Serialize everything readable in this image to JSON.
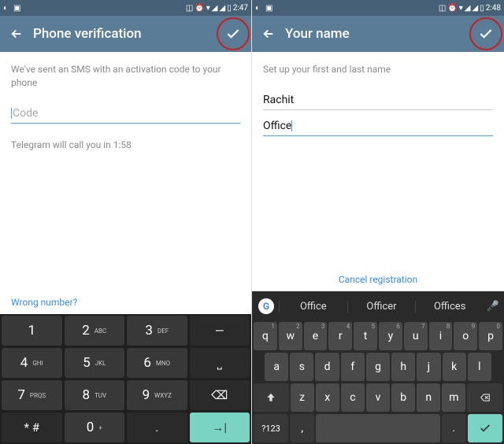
{
  "left": {
    "status_time": "2:47",
    "appbar_title": "Phone verification",
    "helper": "We've sent an SMS with an activation code to your phone",
    "code_placeholder": "Code",
    "countdown": "Telegram will call you in 1:58",
    "wrong_link": "Wrong number?",
    "keypad": {
      "r1c1": "1",
      "r1c2": "2",
      "r1c2l": "ABC",
      "r1c3": "3",
      "r1c3l": "DEF",
      "r1c4": "—",
      "r2c1": "4",
      "r2c1l": "GHI",
      "r2c2": "5",
      "r2c2l": "JKL",
      "r2c3": "6",
      "r2c3l": "MNO",
      "r2c4": "⎵",
      "r3c1": "7",
      "r3c1l": "PRQS",
      "r3c2": "8",
      "r3c2l": "TUV",
      "r3c3": "9",
      "r3c3l": "WXYZ",
      "r3c4": "⌫",
      "r4c1": "* #",
      "r4c2": "0",
      "r4c2l": "+",
      "r4c3": ".",
      "r4c4": "→|"
    }
  },
  "right": {
    "status_time": "2:48",
    "appbar_title": "Your name",
    "helper": "Set up your first and last name",
    "first_name": "Rachit",
    "last_name": "Office",
    "cancel_link": "Cancel registration",
    "suggestions": {
      "s1": "Office",
      "s2": "Officer",
      "s3": "Offices"
    },
    "qwerty": {
      "row1": [
        "q",
        "w",
        "e",
        "r",
        "t",
        "y",
        "u",
        "i",
        "o",
        "p"
      ],
      "row1_sup": [
        "1",
        "2",
        "3",
        "4",
        "5",
        "6",
        "7",
        "8",
        "9",
        "0"
      ],
      "row2": [
        "a",
        "s",
        "d",
        "f",
        "g",
        "h",
        "j",
        "k",
        "l"
      ],
      "row3": [
        "z",
        "x",
        "c",
        "v",
        "b",
        "n",
        "m"
      ],
      "sym": "?123",
      "comma": ",",
      "period": "."
    }
  }
}
